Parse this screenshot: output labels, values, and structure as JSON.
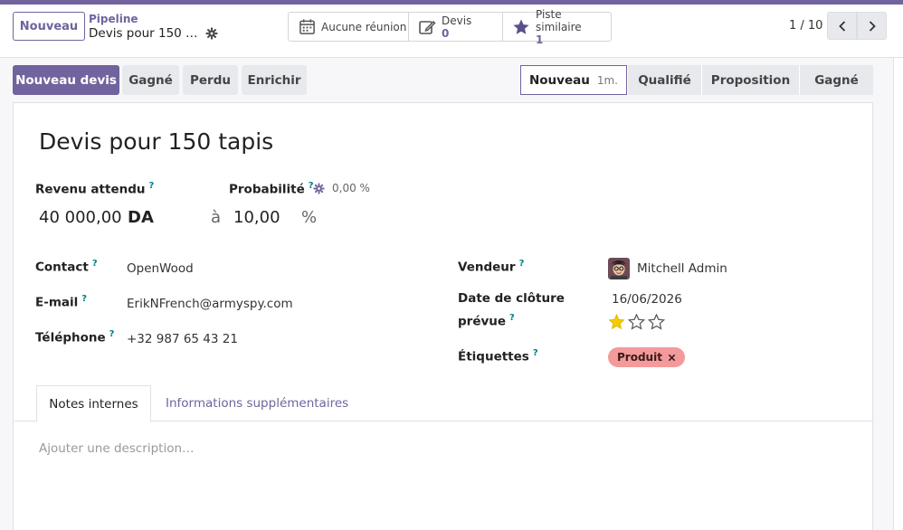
{
  "header": {
    "new_button": "Nouveau",
    "breadcrumb_parent": "Pipeline",
    "breadcrumb_current": "Devis pour 150 …",
    "smart_buttons": [
      {
        "label": "Aucune réunion",
        "count": ""
      },
      {
        "label": "Devis",
        "count": "0"
      },
      {
        "label": "Piste similaire",
        "count": "1"
      }
    ],
    "pager": "1 / 10"
  },
  "actions": {
    "new_quote": "Nouveau devis",
    "won": "Gagné",
    "lost": "Perdu",
    "enrich": "Enrichir"
  },
  "stages": [
    {
      "label": "Nouveau",
      "duration": "1m.",
      "active": true
    },
    {
      "label": "Qualifié"
    },
    {
      "label": "Proposition"
    },
    {
      "label": "Gagné"
    }
  ],
  "form": {
    "title": "Devis pour 150 tapis",
    "expected_revenue_label": "Revenu attendu",
    "expected_revenue_value": "40 000,00",
    "currency": "DA",
    "at": "à",
    "probability_label": "Probabilité",
    "probability_value": "10,00",
    "percent": "%",
    "auto_probability": "0,00 %",
    "contact_label": "Contact",
    "contact_value": "OpenWood",
    "email_label": "E-mail",
    "email_value": "ErikNFrench@armyspy.com",
    "phone_label": "Téléphone",
    "phone_value": "+32 987 65 43 21",
    "salesperson_label": "Vendeur",
    "salesperson_value": "Mitchell Admin",
    "deadline_label_line1": "Date de clôture",
    "deadline_label_line2": "prévue",
    "deadline_value": "16/06/2026",
    "priority_stars": 1,
    "tags_label": "Étiquettes",
    "tag": "Produit",
    "help_mark": "?"
  },
  "tabs": {
    "notes": "Notes internes",
    "extra": "Informations supplémentaires",
    "description_placeholder": "Ajouter une description…"
  },
  "colors": {
    "brand": "#71639e",
    "tag": "#f49a9a",
    "star": "#f3cc00"
  }
}
